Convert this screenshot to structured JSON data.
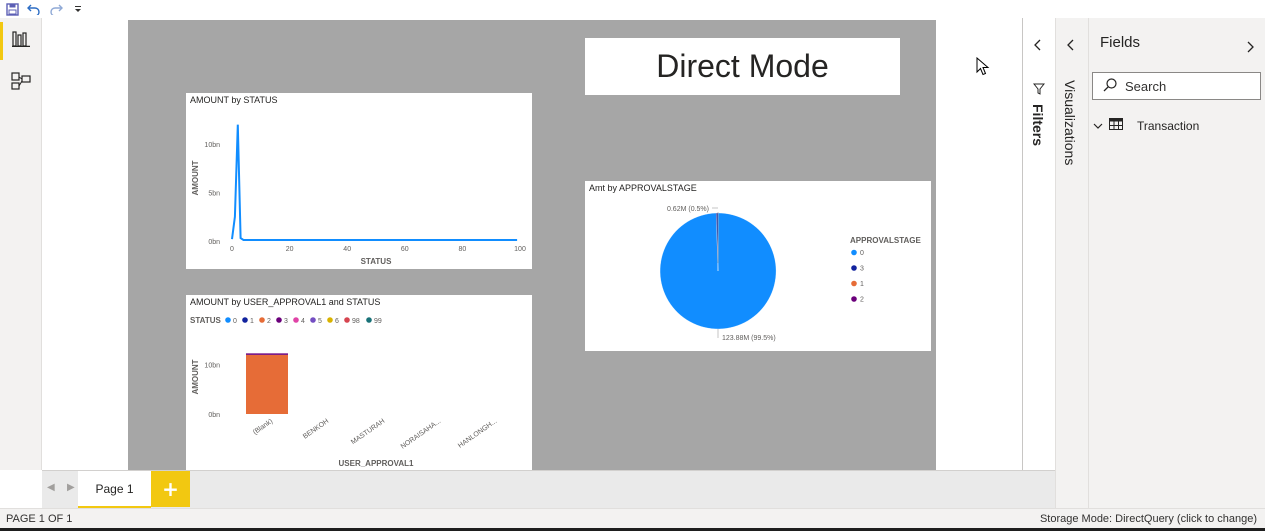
{
  "toolbar": {
    "save_icon": "save-icon",
    "undo_icon": "undo-icon",
    "redo_icon": "redo-icon",
    "customize_icon": "caret-down-icon"
  },
  "left_rail": {
    "items": [
      {
        "icon": "report-view-icon",
        "active": true
      },
      {
        "icon": "model-view-icon",
        "active": false
      }
    ]
  },
  "canvas": {
    "title_box": "Direct Mode",
    "line_chart": {
      "title": "AMOUNT by STATUS",
      "ylabel": "AMOUNT",
      "xlabel": "STATUS",
      "yticks": [
        "0bn",
        "5bn",
        "10bn"
      ],
      "xticks": [
        "0",
        "20",
        "40",
        "60",
        "80",
        "100"
      ]
    },
    "bar_chart": {
      "title": "AMOUNT by USER_APPROVAL1 and STATUS",
      "legend_title": "STATUS",
      "ylabel": "AMOUNT",
      "xlabel": "USER_APPROVAL1",
      "yticks": [
        "0bn",
        "10bn"
      ]
    },
    "pie_chart": {
      "title": "Amt by APPROVALSTAGE",
      "legend_title": "APPROVALSTAGE",
      "small_label": "0.62M (0.5%)",
      "large_label": "123.88M (99.5%)"
    }
  },
  "chart_data": [
    {
      "type": "line",
      "title": "AMOUNT by STATUS",
      "xlabel": "STATUS",
      "ylabel": "AMOUNT",
      "x": [
        0,
        1,
        2,
        3,
        4,
        5,
        6,
        98,
        99
      ],
      "values": [
        0.2,
        2.5,
        12.0,
        0.3,
        0.1,
        0.1,
        0.1,
        0.1,
        0.1
      ],
      "unit": "bn",
      "xlim": [
        0,
        100
      ],
      "ylim": [
        0,
        13
      ],
      "color": "#118dff"
    },
    {
      "type": "bar",
      "title": "AMOUNT by USER_APPROVAL1 and STATUS",
      "xlabel": "USER_APPROVAL1",
      "ylabel": "AMOUNT",
      "categories": [
        "(Blank)",
        "BENKOH",
        "MASTURAH",
        "NORAISAHA...",
        "HANLONGH..."
      ],
      "legend_title": "STATUS",
      "series": [
        {
          "name": "0",
          "color": "#118dff",
          "values": [
            0,
            0,
            0,
            0,
            0
          ]
        },
        {
          "name": "1",
          "color": "#12239e",
          "values": [
            0,
            0,
            0,
            0,
            0
          ]
        },
        {
          "name": "2",
          "color": "#e66c37",
          "values": [
            12.0,
            0,
            0,
            0,
            0
          ]
        },
        {
          "name": "3",
          "color": "#6b007b",
          "values": [
            0.3,
            0,
            0,
            0,
            0
          ]
        },
        {
          "name": "4",
          "color": "#e044a7",
          "values": [
            0,
            0,
            0,
            0,
            0
          ]
        },
        {
          "name": "5",
          "color": "#744ec2",
          "values": [
            0,
            0,
            0,
            0,
            0
          ]
        },
        {
          "name": "6",
          "color": "#d9b300",
          "values": [
            0,
            0,
            0,
            0,
            0
          ]
        },
        {
          "name": "98",
          "color": "#d64550",
          "values": [
            0,
            0,
            0,
            0,
            0
          ]
        },
        {
          "name": "99",
          "color": "#197278",
          "values": [
            0,
            0,
            0,
            0,
            0
          ]
        }
      ],
      "unit": "bn",
      "ylim": [
        0,
        14
      ]
    },
    {
      "type": "pie",
      "title": "Amt by APPROVALSTAGE",
      "legend_title": "APPROVALSTAGE",
      "categories": [
        "0",
        "3",
        "1",
        "2"
      ],
      "values": [
        123.88,
        0.62,
        0.0,
        0.0
      ],
      "unit": "M",
      "labels": [
        "123.88M (99.5%)",
        "0.62M (0.5%)"
      ],
      "colors": [
        "#118dff",
        "#12239e",
        "#e66c37",
        "#6b007b"
      ]
    }
  ],
  "filters_pane": {
    "label": "Filters",
    "collapse_icon": "chevron-left-icon",
    "filter_icon": "funnel-icon"
  },
  "viz_pane": {
    "label": "Visualizations",
    "collapse_icon": "chevron-left-icon"
  },
  "fields_pane": {
    "title": "Fields",
    "expand_icon": "chevron-right-icon",
    "search_placeholder": "Search",
    "tables": [
      {
        "name": "Transaction",
        "icon": "table-icon"
      }
    ]
  },
  "page_tabs": {
    "tabs": [
      "Page 1"
    ],
    "add_label": "+"
  },
  "status_bar": {
    "page_info": "PAGE 1 OF 1",
    "storage_mode": "Storage Mode: DirectQuery (click to change)"
  }
}
